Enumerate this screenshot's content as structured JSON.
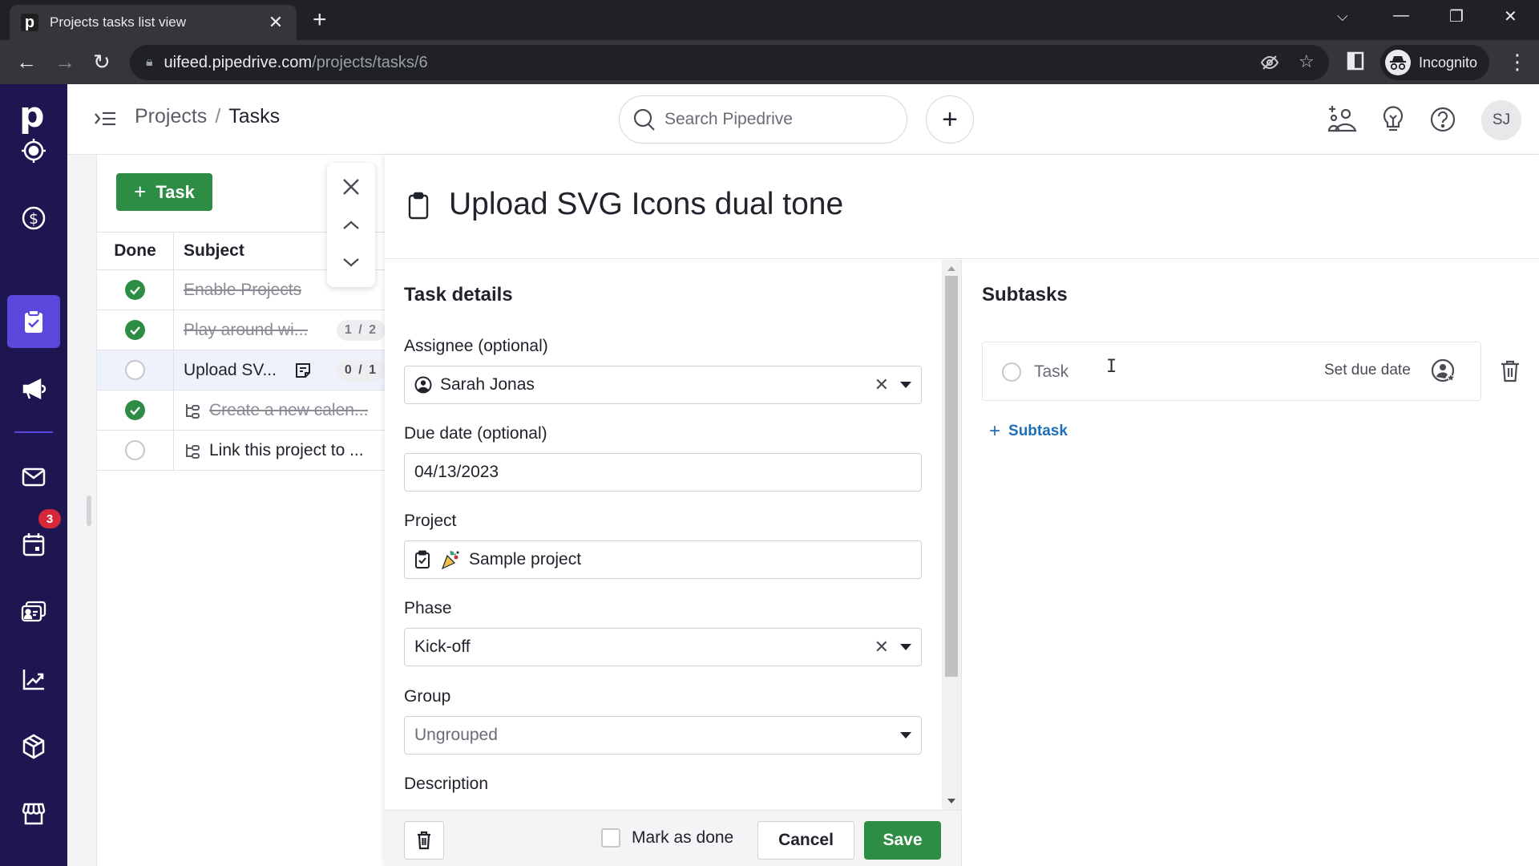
{
  "browser": {
    "tab_title": "Projects tasks list view",
    "tab_favicon": "p",
    "url_host": "uifeed.pipedrive.com",
    "url_path": "/projects/tasks/6",
    "profile_label": "Incognito"
  },
  "sidebar": {
    "logo": "p",
    "items": [
      {
        "name": "leads",
        "icon": "target-icon"
      },
      {
        "name": "deals",
        "icon": "dollar-icon"
      },
      {
        "name": "projects",
        "icon": "clipboard-check-icon",
        "active": true
      },
      {
        "name": "campaigns",
        "icon": "megaphone-icon"
      },
      {
        "name": "mail",
        "icon": "mail-icon"
      },
      {
        "name": "activities",
        "icon": "calendar-icon",
        "badge": "3"
      },
      {
        "name": "contacts",
        "icon": "contact-card-icon"
      },
      {
        "name": "insights",
        "icon": "trend-chart-icon"
      },
      {
        "name": "products",
        "icon": "box-icon"
      },
      {
        "name": "marketplace",
        "icon": "store-icon"
      }
    ]
  },
  "header": {
    "breadcrumb": {
      "parent": "Projects",
      "separator": "/",
      "current": "Tasks"
    },
    "search_placeholder": "Search Pipedrive",
    "avatar_initials": "SJ"
  },
  "task_list": {
    "add_button_label": "Task",
    "columns": {
      "done": "Done",
      "subject": "Subject"
    },
    "rows": [
      {
        "subject": "Enable Projects",
        "done": true,
        "subtask": false,
        "count": null,
        "note": false
      },
      {
        "subject": "Play around wi...",
        "done": true,
        "subtask": false,
        "count": "1 / 2",
        "note": false
      },
      {
        "subject": "Upload SV...",
        "done": false,
        "subtask": false,
        "count": "0 / 1",
        "note": true,
        "selected": true
      },
      {
        "subject": "Create a new calen...",
        "done": true,
        "subtask": true,
        "count": null,
        "note": false
      },
      {
        "subject": "Link this project to ...",
        "done": false,
        "subtask": true,
        "count": null,
        "note": false
      }
    ]
  },
  "detail": {
    "title": "Upload SVG Icons dual tone",
    "section_title": "Task details",
    "fields": {
      "assignee": {
        "label": "Assignee (optional)",
        "value": "Sarah Jonas"
      },
      "due_date": {
        "label": "Due date (optional)",
        "value": "04/13/2023"
      },
      "project": {
        "label": "Project",
        "value": "Sample project"
      },
      "phase": {
        "label": "Phase",
        "value": "Kick-off"
      },
      "group": {
        "label": "Group",
        "value": "Ungrouped"
      },
      "description": {
        "label": "Description"
      }
    },
    "footer": {
      "mark_done_label": "Mark as done",
      "mark_done_checked": false,
      "cancel_label": "Cancel",
      "save_label": "Save"
    },
    "subtasks": {
      "title": "Subtasks",
      "new_subtask_placeholder": "Task",
      "set_due_date_label": "Set due date",
      "add_subtask_label": "Subtask"
    }
  },
  "colors": {
    "sidebar_bg": "#1e1650",
    "sidebar_active": "#5b47db",
    "primary_green": "#2e8d44",
    "link_blue": "#1d6fb7",
    "badge_red": "#d6283b"
  }
}
